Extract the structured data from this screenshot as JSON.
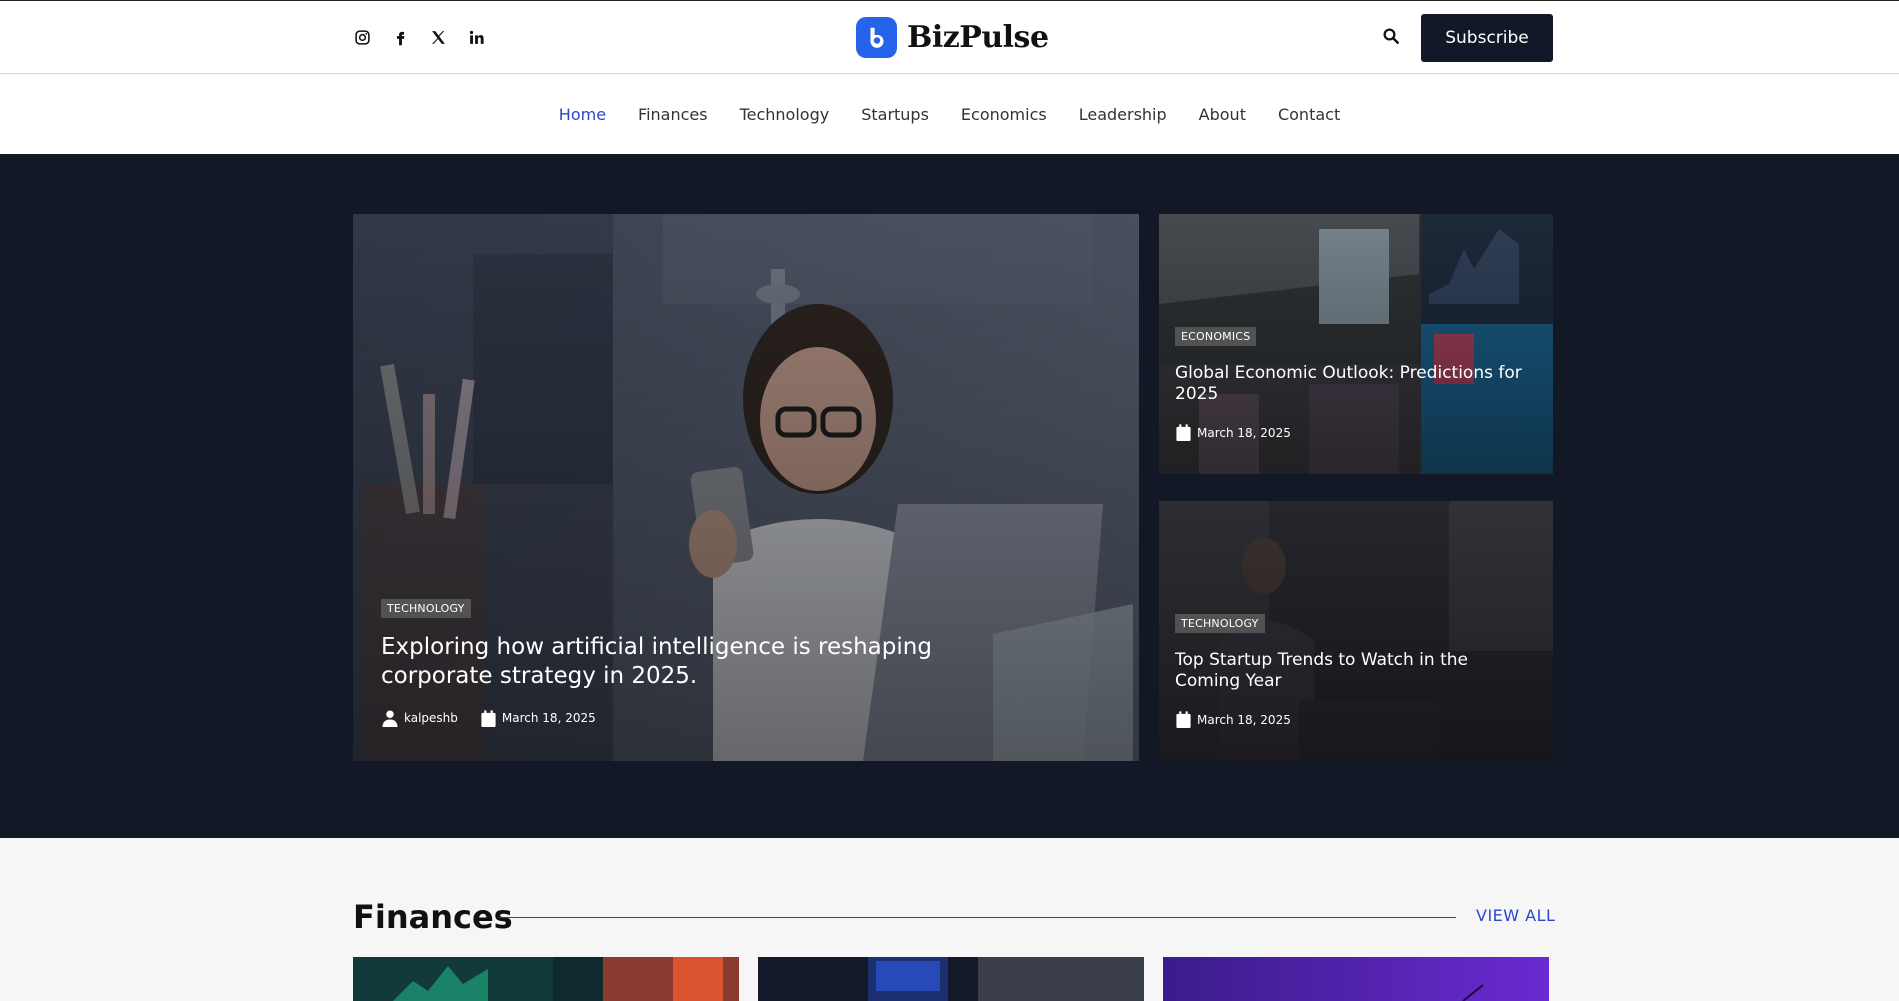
{
  "header": {
    "brand": "BizPulse",
    "social": [
      "instagram-icon",
      "facebook-icon",
      "x-icon",
      "linkedin-icon"
    ],
    "subscribe_label": "Subscribe",
    "brand_color": "#2563eb"
  },
  "nav": {
    "items": [
      "Home",
      "Finances",
      "Technology",
      "Startups",
      "Economics",
      "Leadership",
      "About",
      "Contact"
    ],
    "active": "Home"
  },
  "hero": {
    "main": {
      "category": "TECHNOLOGY",
      "title": "Exploring how artificial intelligence is reshaping corporate strategy in 2025.",
      "author": "kalpeshb",
      "date": "March 18, 2025"
    },
    "side": [
      {
        "category": "ECONOMICS",
        "title": "Global Economic Outlook: Predictions for 2025",
        "date": "March 18, 2025"
      },
      {
        "category": "TECHNOLOGY",
        "title": "Top Startup Trends to Watch in the Coming Year",
        "date": "March 18, 2025"
      }
    ]
  },
  "finances": {
    "title": "Finances",
    "view_all": "VIEW ALL"
  }
}
